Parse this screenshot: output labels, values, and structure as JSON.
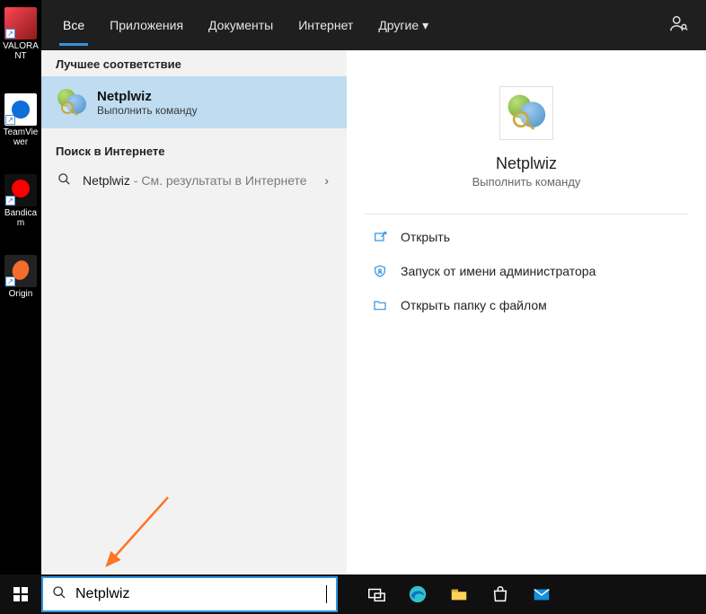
{
  "desktop": {
    "icons": [
      {
        "label": "VALORANT"
      },
      {
        "label": "TeamViewer"
      },
      {
        "label": "Bandicam"
      },
      {
        "label": "Origin"
      }
    ]
  },
  "tabs": {
    "items": [
      {
        "label": "Все",
        "active": true
      },
      {
        "label": "Приложения",
        "active": false
      },
      {
        "label": "Документы",
        "active": false
      },
      {
        "label": "Интернет",
        "active": false
      },
      {
        "label": "Другие",
        "active": false,
        "hasDropdown": true
      }
    ]
  },
  "left": {
    "best_match_header": "Лучшее соответствие",
    "best_match": {
      "title": "Netplwiz",
      "subtitle": "Выполнить команду"
    },
    "web_header": "Поиск в Интернете",
    "web_row": {
      "term": "Netplwiz",
      "suffix": " - См. результаты в Интернете"
    }
  },
  "preview": {
    "title": "Netplwiz",
    "subtitle": "Выполнить команду",
    "actions": [
      {
        "icon": "open",
        "label": "Открыть"
      },
      {
        "icon": "admin",
        "label": "Запуск от имени администратора"
      },
      {
        "icon": "folder",
        "label": "Открыть папку с файлом"
      }
    ]
  },
  "search": {
    "value": "Netplwiz"
  }
}
